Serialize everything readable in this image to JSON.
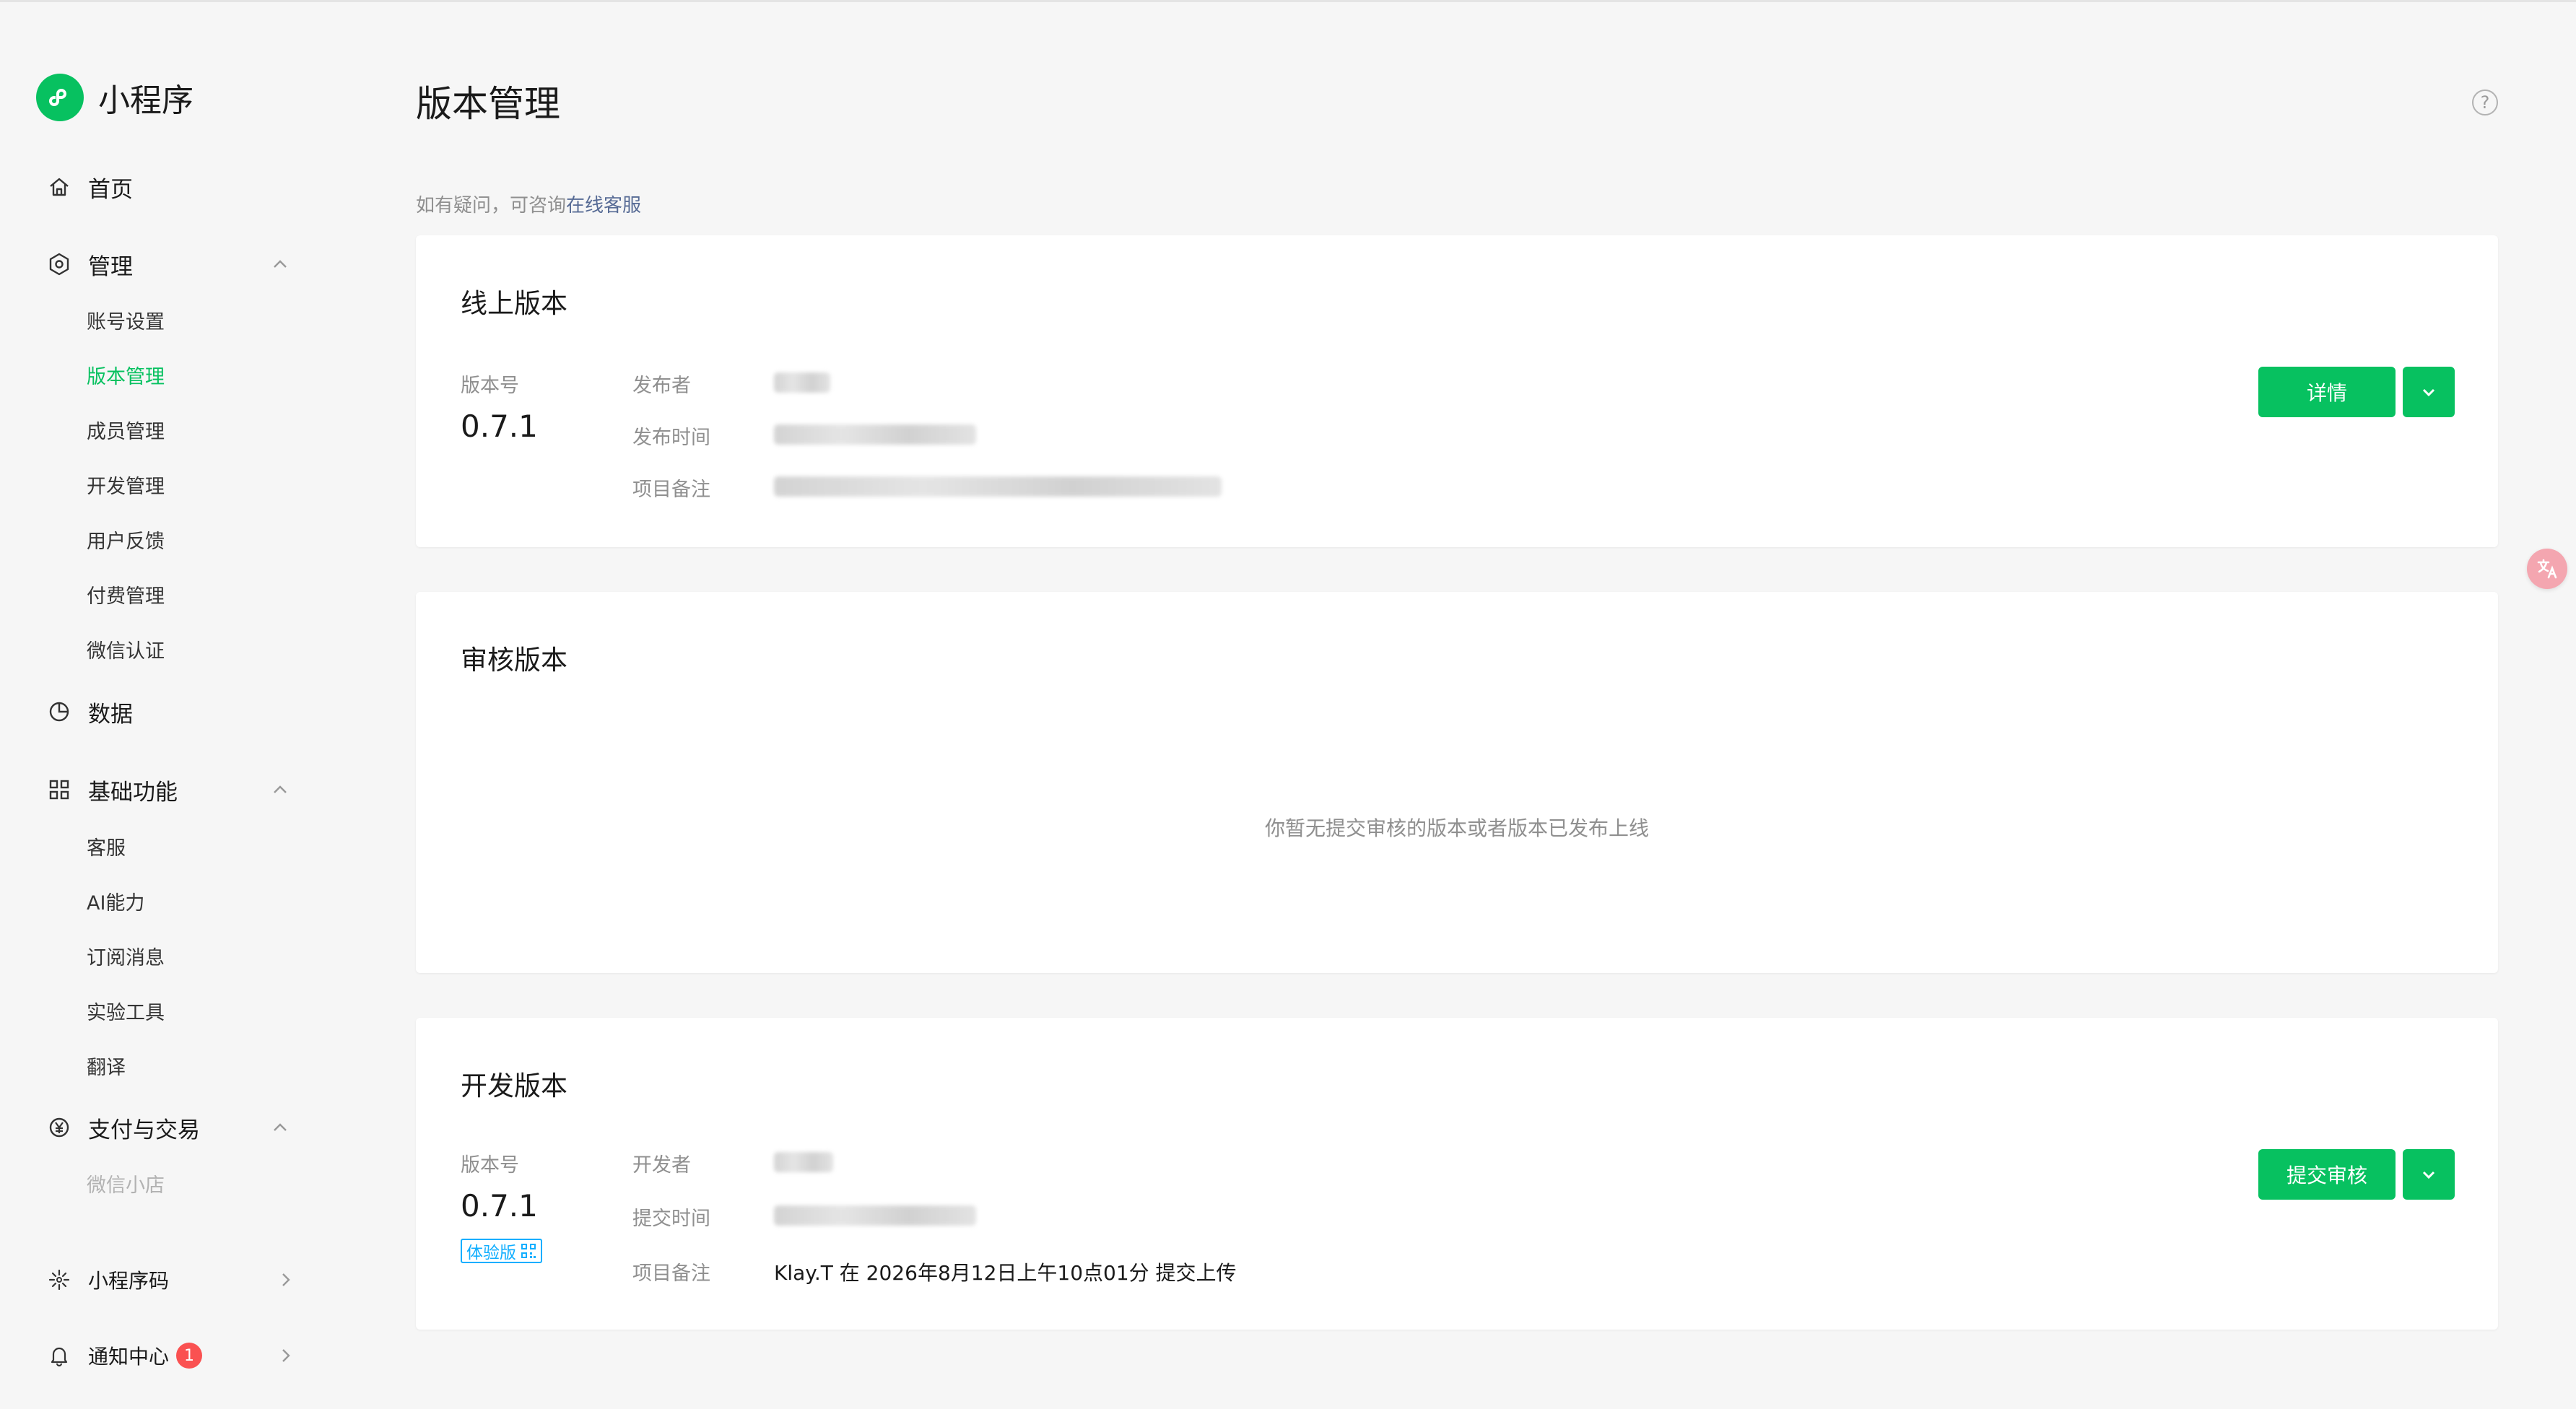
{
  "app": {
    "name": "小程序",
    "brand_color": "#07c160",
    "logo_icon": "miniprogram-logo-icon"
  },
  "sidebar": {
    "home": {
      "label": "首页",
      "icon": "home-icon"
    },
    "manage": {
      "label": "管理",
      "icon": "gear-icon",
      "expanded": true,
      "items": [
        "账号设置",
        "版本管理",
        "成员管理",
        "开发管理",
        "用户反馈",
        "付费管理",
        "微信认证"
      ],
      "active": "版本管理"
    },
    "data": {
      "label": "数据",
      "icon": "pie-chart-icon"
    },
    "basic": {
      "label": "基础功能",
      "icon": "grid-icon",
      "expanded": true,
      "items": [
        "客服",
        "AI能力",
        "订阅消息",
        "实验工具",
        "翻译"
      ]
    },
    "payment": {
      "label": "支付与交易",
      "icon": "yen-icon",
      "expanded": true,
      "items": [
        "微信小店"
      ]
    },
    "qrcode": {
      "label": "小程序码",
      "icon": "sun-icon"
    },
    "notify": {
      "label": "通知中心",
      "icon": "bell-icon",
      "badge": "1"
    }
  },
  "main": {
    "title": "版本管理",
    "hint_prefix": "如有疑问，可咨询",
    "hint_link": "在线客服",
    "online": {
      "title": "线上版本",
      "version_label": "版本号",
      "version": "0.7.1",
      "publisher_label": "发布者",
      "time_label": "发布时间",
      "note_label": "项目备注",
      "detail_button": "详情"
    },
    "review": {
      "title": "审核版本",
      "empty": "你暂无提交审核的版本或者版本已发布上线"
    },
    "dev": {
      "title": "开发版本",
      "version_label": "版本号",
      "version": "0.7.1",
      "tag": "体验版",
      "developer_label": "开发者",
      "time_label": "提交时间",
      "note_label": "项目备注",
      "note": "Klay.T 在 2026年8月12日上午10点01分 提交上传",
      "submit_button": "提交审核"
    }
  }
}
